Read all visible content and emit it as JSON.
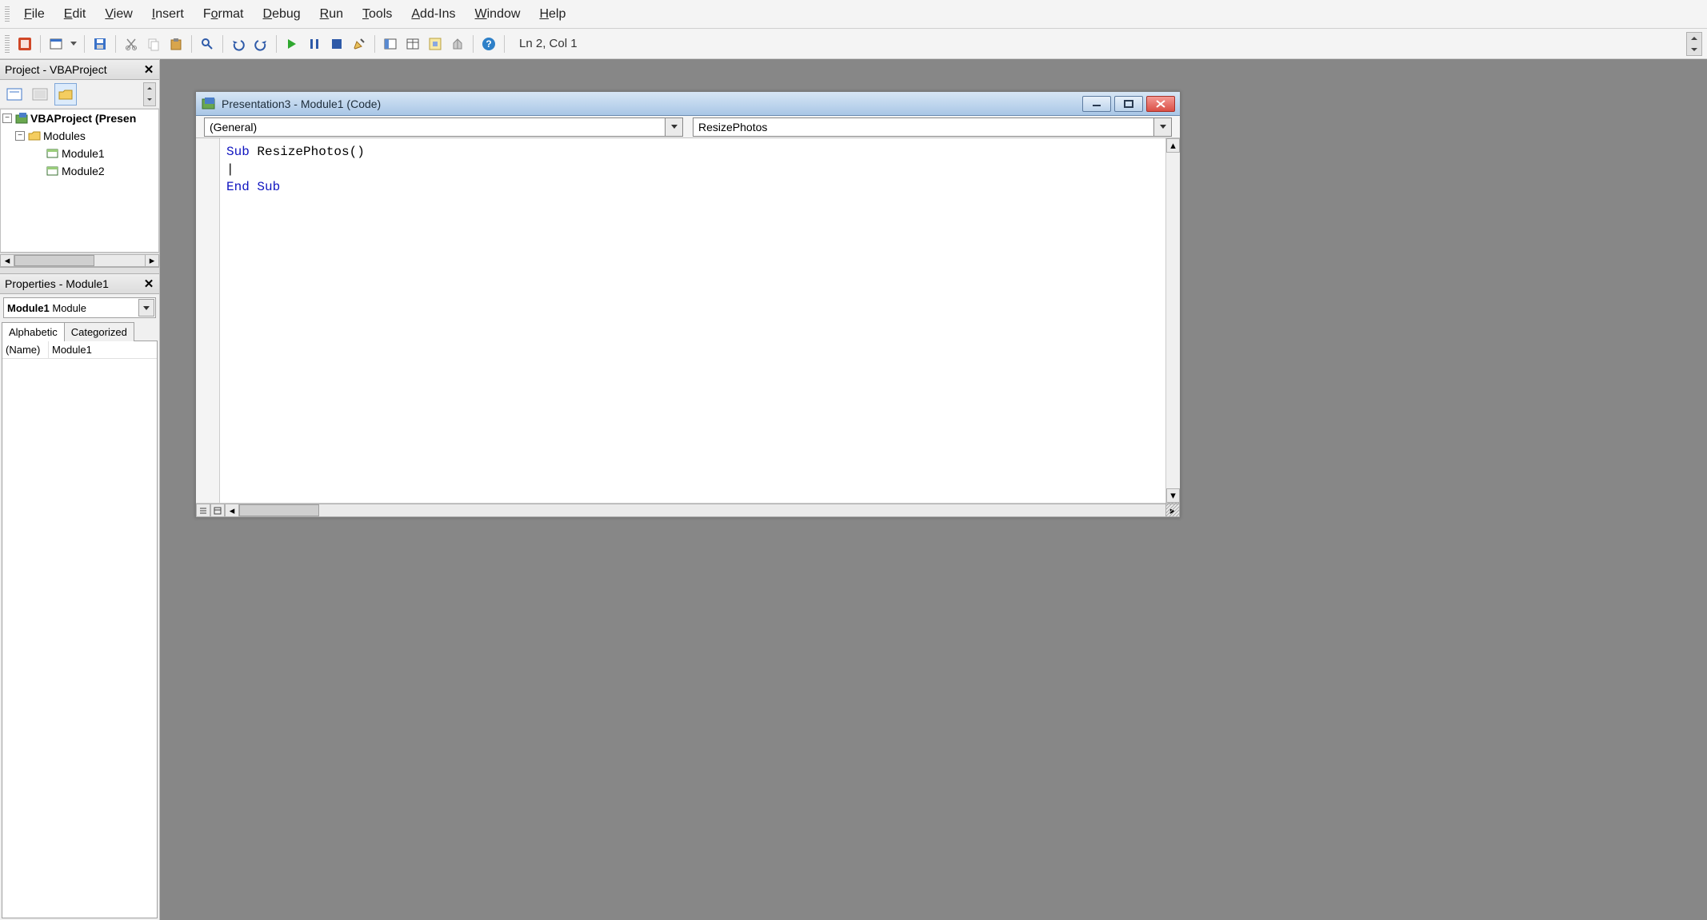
{
  "menus": {
    "file": "File",
    "edit": "Edit",
    "view": "View",
    "insert": "Insert",
    "format": "Format",
    "debug": "Debug",
    "run": "Run",
    "tools": "Tools",
    "addins": "Add-Ins",
    "window": "Window",
    "help": "Help"
  },
  "toolbar": {
    "cursor_position": "Ln 2, Col 1"
  },
  "project_panel": {
    "title": "Project - VBAProject",
    "root": "VBAProject (Presen",
    "modules_folder": "Modules",
    "modules": [
      "Module1",
      "Module2"
    ]
  },
  "properties_panel": {
    "title": "Properties - Module1",
    "object_name": "Module1",
    "object_type": "Module",
    "tabs": {
      "alphabetic": "Alphabetic",
      "categorized": "Categorized"
    },
    "rows": [
      {
        "key": "(Name)",
        "value": "Module1"
      }
    ]
  },
  "codewin": {
    "title": "Presentation3 - Module1 (Code)",
    "left_dd": "(General)",
    "right_dd": "ResizePhotos",
    "line1a": "Sub",
    "line1b": " ResizePhotos()",
    "cursor_line": "|",
    "line3a": "End",
    "line3b": " ",
    "line3c": "Sub"
  }
}
